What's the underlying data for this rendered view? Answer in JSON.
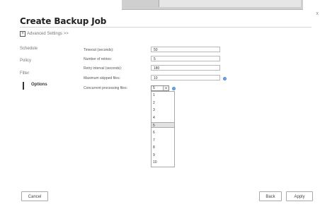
{
  "header": {
    "title": "Create Backup Job",
    "close_glyph": "x"
  },
  "advanced": {
    "toggle_glyph": "+",
    "label": "Advanced Settings >>"
  },
  "sidebar": {
    "items": [
      {
        "label": "Schedule",
        "active": false
      },
      {
        "label": "Policy",
        "active": false
      },
      {
        "label": "Filter",
        "active": false
      },
      {
        "label": "Options",
        "active": true
      }
    ]
  },
  "options": {
    "rows": [
      {
        "label": "Timeout (seconds):",
        "value": "50"
      },
      {
        "label": "Number of retries:",
        "value": "5"
      },
      {
        "label": "Retry interval (seconds):",
        "value": "180"
      },
      {
        "label": "Maximum skipped files:",
        "value": "10"
      }
    ]
  },
  "concurrent": {
    "label": "Concurrent processing files:",
    "selected": "5",
    "arrow_glyph": "▾",
    "options": [
      "1",
      "2",
      "3",
      "4",
      "5",
      "6",
      "7",
      "8",
      "9",
      "10"
    ]
  },
  "help_glyph": "?",
  "buttons": {
    "cancel": "Cancel",
    "back": "Back",
    "apply": "Apply"
  },
  "colors": {
    "help_icon": "#4e8fd6",
    "selected_option_bg": "#e2e2e2"
  }
}
